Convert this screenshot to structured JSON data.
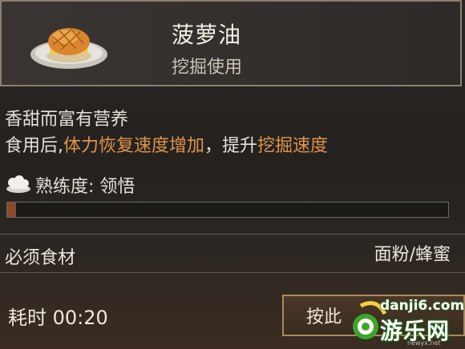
{
  "item": {
    "name": "菠萝油",
    "usage": "挖掘使用",
    "icon": "pineapple-bun-dish-icon"
  },
  "description": {
    "line1": "香甜而富有营养",
    "line2_prefix": "食用后,",
    "line2_highlight1": "体力恢复速度增加",
    "line2_mid": "，提升",
    "line2_highlight2": "挖掘速度"
  },
  "proficiency": {
    "label": "熟练度: 领悟",
    "icon": "chef-hat-icon",
    "progress_fraction": 0.02
  },
  "ingredients": {
    "label": "必须食材",
    "value": "面粉/蜂蜜"
  },
  "cooking": {
    "time_label": "耗时 00:20",
    "button_label": "按此"
  },
  "watermark": {
    "url": "danji6.com",
    "name": "游乐网",
    "small": "newyx.net"
  },
  "colors": {
    "highlight": "#e0934a",
    "progress": "#8a4a2c"
  }
}
